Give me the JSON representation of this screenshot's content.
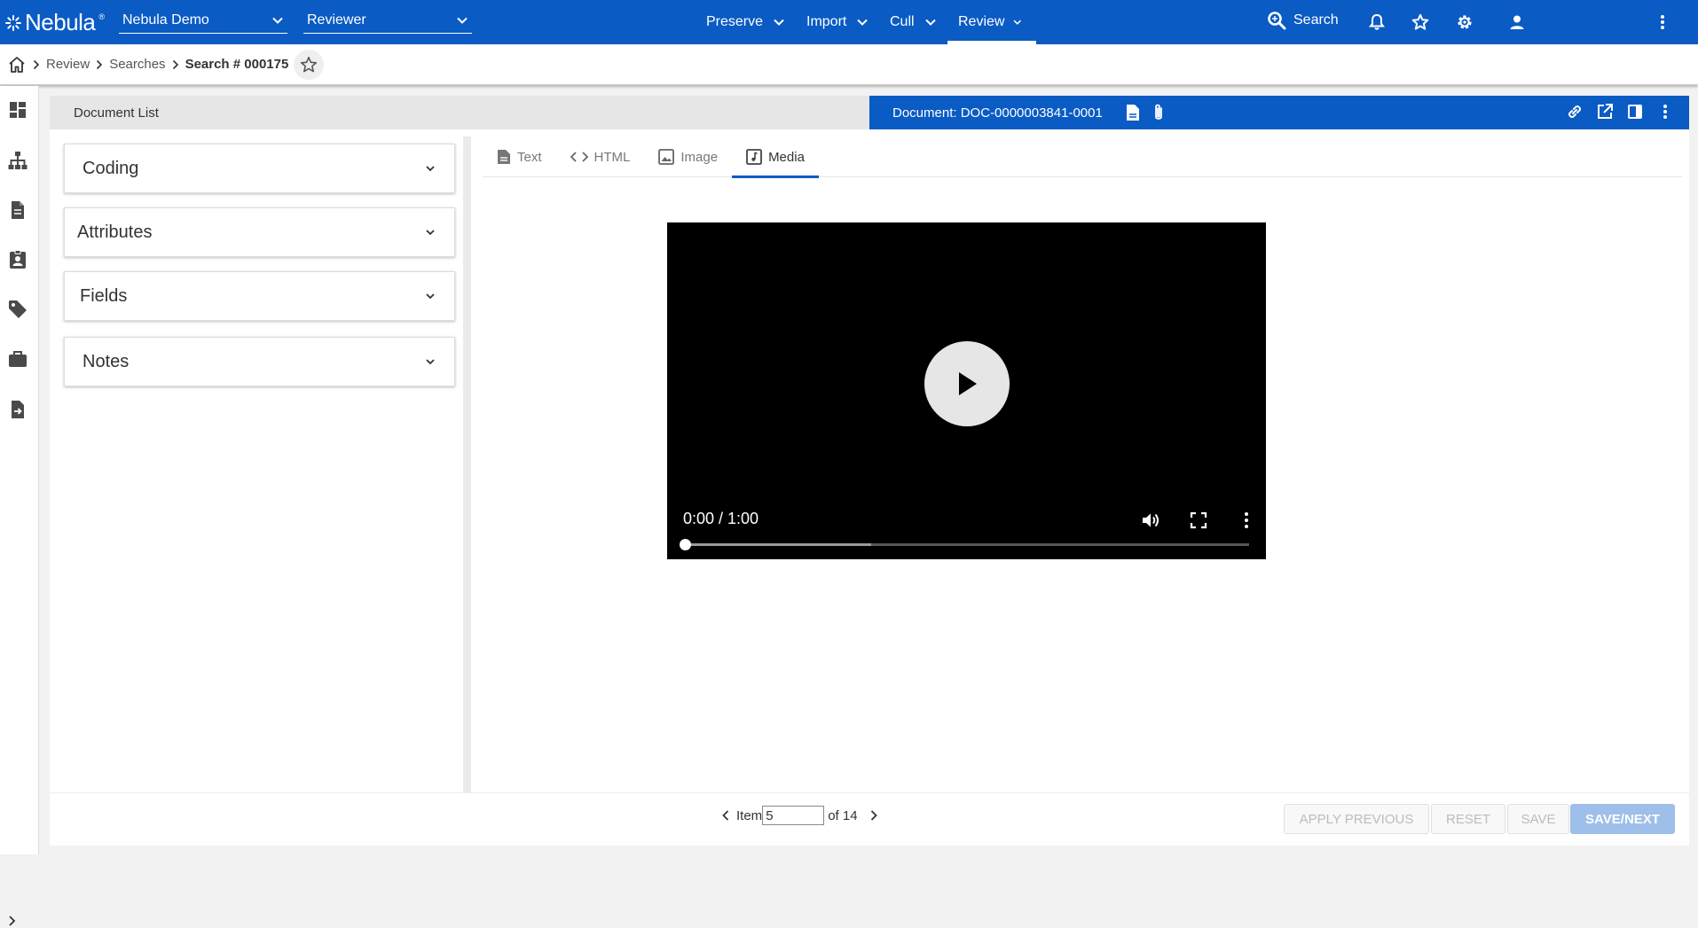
{
  "app": {
    "logo_text": "Nebula",
    "logo_tm": "®",
    "project_select": "Nebula Demo",
    "role_select": "Reviewer",
    "nav": [
      {
        "label": "Preserve"
      },
      {
        "label": "Import"
      },
      {
        "label": "Cull"
      },
      {
        "label": "Review"
      }
    ],
    "active_nav": "Review",
    "search_label": "Search",
    "brand_color": "#0a5bc4"
  },
  "breadcrumb": {
    "items": [
      "Review",
      "Searches"
    ],
    "current": "Search # 000175"
  },
  "rail_icons": [
    "dashboard-icon",
    "hierarchy-icon",
    "document-icon",
    "contact-badge-icon",
    "tag-icon",
    "briefcase-icon",
    "export-document-icon"
  ],
  "document_list": {
    "title": "Document List"
  },
  "document": {
    "title": "Document: DOC-0000003841-0001"
  },
  "panels": [
    "Coding",
    "Attributes",
    "Fields",
    "Notes"
  ],
  "tabs": [
    {
      "label": "Text",
      "icon": "text-doc-icon"
    },
    {
      "label": "HTML",
      "icon": "code-icon"
    },
    {
      "label": "Image",
      "icon": "image-icon"
    },
    {
      "label": "Media",
      "icon": "media-icon"
    }
  ],
  "active_tab": "Media",
  "player": {
    "time": "0:00 / 1:00",
    "progress_fraction": 0.0,
    "buffered_fraction": 0.33
  },
  "pager": {
    "prefix": "Item",
    "current": "5",
    "suffix": "of 14"
  },
  "actions": {
    "apply_previous": "APPLY PREVIOUS",
    "reset": "RESET",
    "save": "SAVE",
    "save_next": "SAVE/NEXT"
  }
}
